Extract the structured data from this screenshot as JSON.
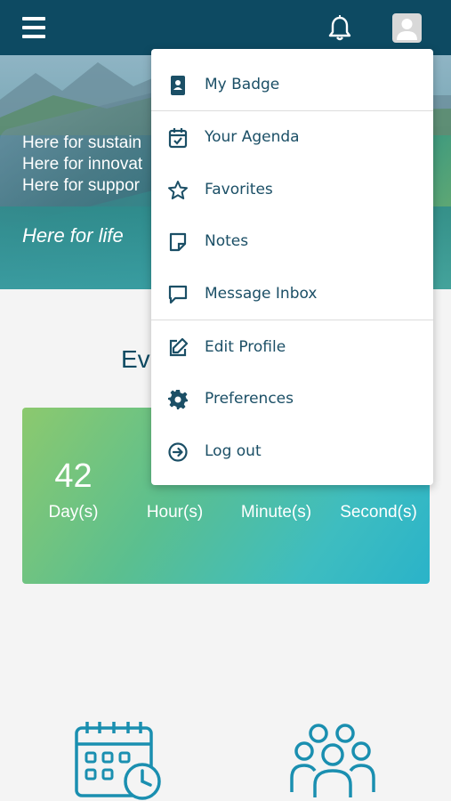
{
  "topbar": {
    "menu_icon": "hamburger-icon",
    "notifications_icon": "bell-icon",
    "profile_icon": "user-avatar-icon",
    "background_color": "#0d4a62"
  },
  "hero": {
    "lines": [
      "Here for sustain",
      "Here for innovat",
      "Here for suppor"
    ],
    "tagline": "Here for life"
  },
  "event": {
    "title": "Ev"
  },
  "countdown": {
    "days": {
      "value": "42",
      "label": "Day(s)"
    },
    "hours": {
      "value": "",
      "label": "Hour(s)"
    },
    "minutes": {
      "value": "",
      "label": "Minute(s)"
    },
    "seconds": {
      "value": "",
      "label": "Second(s)"
    }
  },
  "bottom_icons": [
    "calendar-clock-icon",
    "group-people-icon"
  ],
  "dropdown_menu": {
    "items": [
      {
        "label": "My Badge",
        "icon": "badge-icon"
      },
      {
        "label": "Your Agenda",
        "icon": "calendar-check-icon"
      },
      {
        "label": "Favorites",
        "icon": "star-icon"
      },
      {
        "label": "Notes",
        "icon": "note-icon"
      },
      {
        "label": "Message Inbox",
        "icon": "message-icon"
      },
      {
        "label": "Edit Profile",
        "icon": "edit-icon"
      },
      {
        "label": "Preferences",
        "icon": "gear-icon"
      },
      {
        "label": "Log out",
        "icon": "logout-icon"
      }
    ]
  },
  "colors": {
    "brand_dark": "#0d4a62",
    "menu_text": "#1b4f66",
    "icon_teal": "#1a8fb0"
  }
}
